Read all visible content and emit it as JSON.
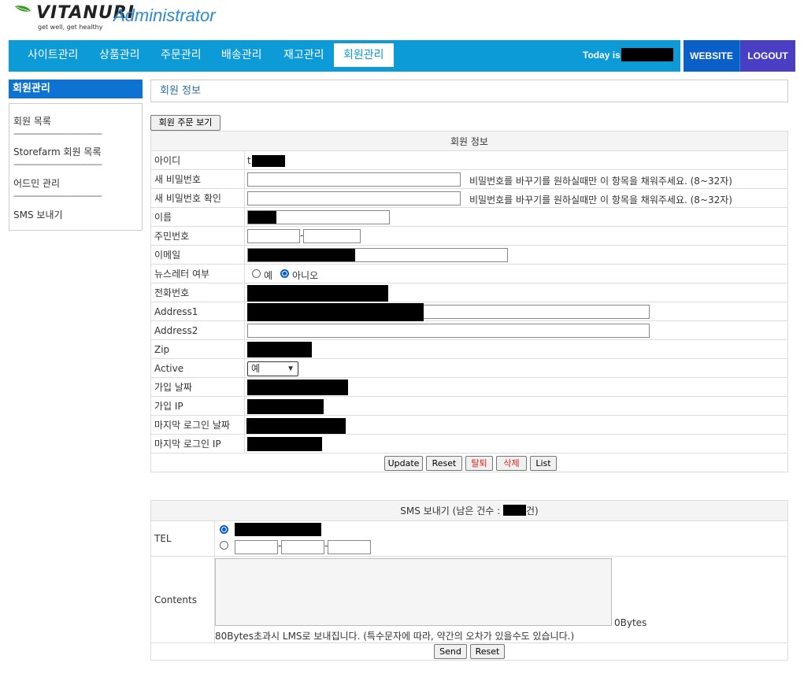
{
  "brand": {
    "logo_text": "VITANURI",
    "tagline": "get well, get healthy",
    "title": "Administrator"
  },
  "nav": {
    "items": [
      "사이트관리",
      "상품관리",
      "주문관리",
      "배송관리",
      "재고관리",
      "회원관리"
    ],
    "active": "회원관리",
    "today_label": "Today is",
    "website": "WEBSITE",
    "logout": "LOGOUT"
  },
  "sidebar": {
    "title": "회원관리",
    "items": [
      "회원 목록",
      "Storefarm 회원 목록",
      "어드민 관리",
      "SMS 보내기"
    ],
    "divider": "------------------------------------------------"
  },
  "content": {
    "title": "회원 정보",
    "orders_button": "회원 주문 보기",
    "table_header": "회원 정보",
    "fields": {
      "id": "아이디",
      "id_prefix": "t",
      "new_password": "새 비밀번호",
      "new_password_confirm": "새 비밀번호 확인",
      "password_hint": "비밀번호를 바꾸기를 원하실때만 이 항목을 채워주세요. (8~32자)",
      "name": "이름",
      "ssn": "주민번호",
      "email": "이메일",
      "newsletter": "뉴스레터 여부",
      "newsletter_yes": "예",
      "newsletter_no": "아니오",
      "phone": "전화번호",
      "address1": "Address1",
      "address2": "Address2",
      "zip": "Zip",
      "active": "Active",
      "active_value": "예",
      "join_date": "가입 날짜",
      "join_ip": "가입 IP",
      "last_login_date": "마지막 로그인 날짜",
      "last_login_ip": "마지막 로그인 IP"
    },
    "buttons": {
      "update": "Update",
      "reset": "Reset",
      "withdraw": "탈퇴",
      "delete": "삭제",
      "list": "List"
    }
  },
  "sms": {
    "header_prefix": "SMS 보내기   (남은 건수 : ",
    "header_suffix": "건)",
    "tel_label": "TEL",
    "contents_label": "Contents",
    "bytes": "0Bytes",
    "note": "80Bytes초과시 LMS로 보내집니다. (특수문자에 따라, 약간의 오차가 있을수도 있습니다.)",
    "send": "Send",
    "reset": "Reset"
  }
}
